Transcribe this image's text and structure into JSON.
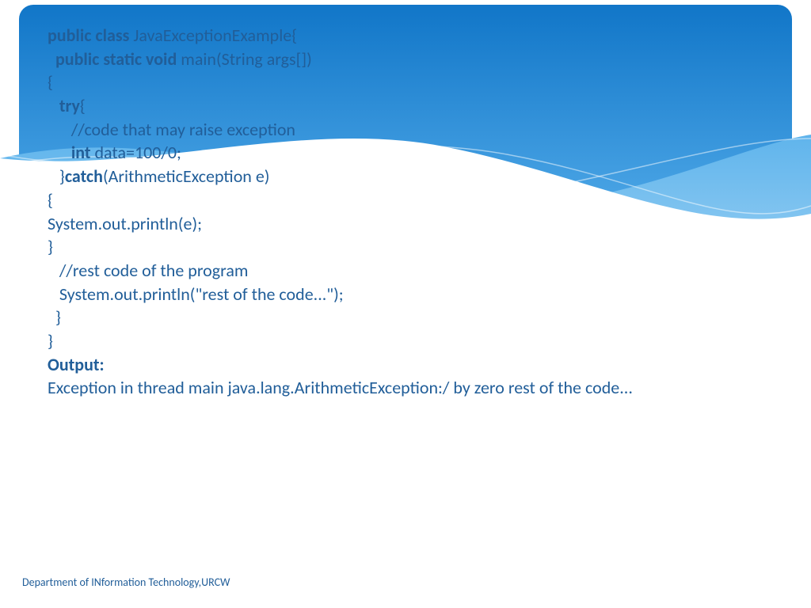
{
  "code": {
    "l1": {
      "kw": "public class",
      "rest": " JavaExceptionExample{"
    },
    "l2": {
      "pre": "  ",
      "kw": "public static void",
      "rest": " main(String args[])"
    },
    "l3": "{",
    "l4": {
      "pre": "   ",
      "kw": "try",
      "rest": "{"
    },
    "l5": "      //code that may raise exception",
    "l6": {
      "pre": "      ",
      "kw": "int",
      "rest": " data=100/0;"
    },
    "l7": {
      "pre": "   }",
      "kw": "catch",
      "rest": "(ArithmeticException e)"
    },
    "l8": "{",
    "l9": "System.out.println(e);",
    "l10": "}",
    "l11": "   //rest code of the program",
    "l12": "   System.out.println(\"rest of the code...\");",
    "l13": "  }",
    "l14": "}",
    "output_label": "Output:",
    "output_text": "Exception in thread main java.lang.ArithmeticException:/ by zero rest of the code..."
  },
  "footer": "Department of INformation Technology,URCW"
}
